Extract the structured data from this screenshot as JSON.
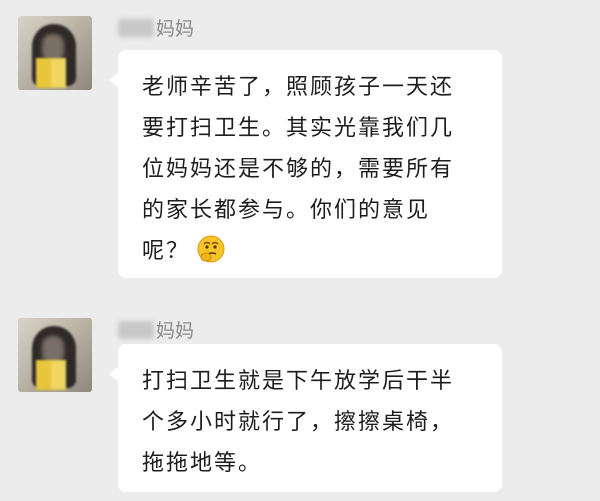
{
  "messages": [
    {
      "sender_suffix": "妈妈",
      "lines": [
        "老师辛苦了，照顾孩子一天还",
        "要打扫卫生。其实光靠我们几",
        "位妈妈还是不够的，需要所有",
        "的家长都参与。你们的意见",
        "呢？"
      ],
      "emoji": "thinking-face-emoji"
    },
    {
      "sender_suffix": "妈妈",
      "lines": [
        "打扫卫生就是下午放学后干半",
        "个多小时就行了，擦擦桌椅，",
        "拖拖地等。"
      ]
    }
  ],
  "colors": {
    "background": "#ececec",
    "bubble": "#ffffff",
    "sender_text": "#8a8a8a",
    "message_text": "#1d1d1d"
  }
}
